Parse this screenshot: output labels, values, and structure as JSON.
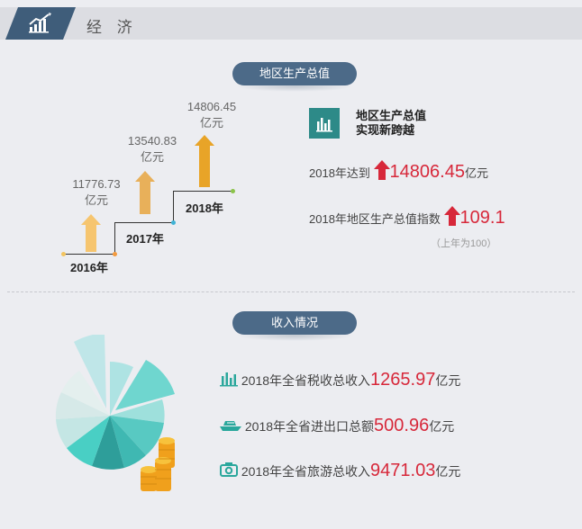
{
  "header": {
    "title": "经 济",
    "icon": "trend-chart-icon"
  },
  "gdp": {
    "section_title": "地区生产总值",
    "years": [
      {
        "year": "2016年",
        "value": "11776.73",
        "unit": "亿元"
      },
      {
        "year": "2017年",
        "value": "13540.83",
        "unit": "亿元"
      },
      {
        "year": "2018年",
        "value": "14806.45",
        "unit": "亿元"
      }
    ],
    "headline_line1": "地区生产总值",
    "headline_line2": "实现新跨越",
    "reach_prefix": "2018年达到",
    "reach_value": "14806.45",
    "reach_unit": "亿元",
    "index_prefix": "2018年地区生产总值指数",
    "index_value": "109.1",
    "index_note": "（上年为100）",
    "colors": {
      "arrow_2016": "#f6c56f",
      "arrow_2017": "#e8b05a",
      "arrow_2018": "#e8a428",
      "accent_red": "#d7283a"
    }
  },
  "income": {
    "section_title": "收入情况",
    "items": [
      {
        "icon": "bar-chart-icon",
        "prefix": "2018年全省税收总收入",
        "value": "1265.97",
        "unit": "亿元"
      },
      {
        "icon": "ship-icon",
        "prefix": "2018年全省进出口总额",
        "value": "500.96",
        "unit": "亿元"
      },
      {
        "icon": "camera-icon",
        "prefix": "2018年全省旅游总收入",
        "value": "9471.03",
        "unit": "亿元"
      }
    ],
    "colors": {
      "teal": "#2aa79c"
    }
  }
}
